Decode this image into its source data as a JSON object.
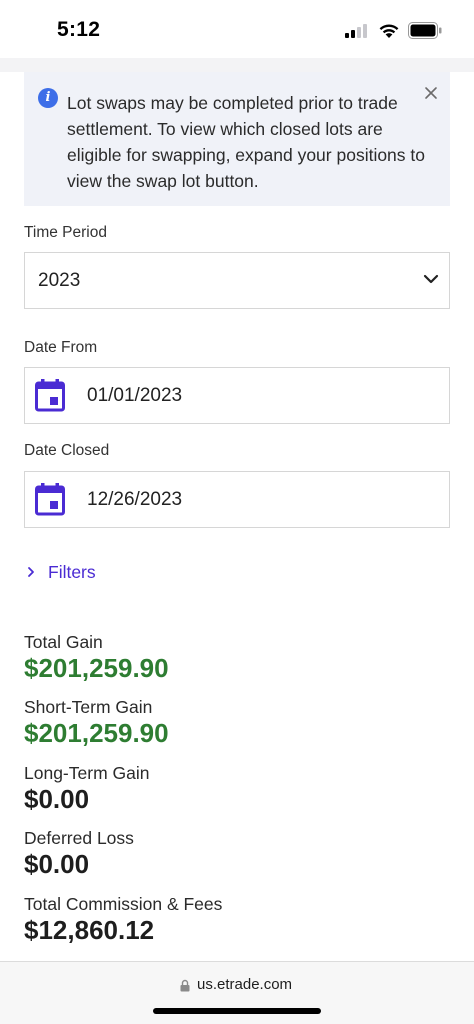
{
  "status_bar": {
    "time": "5:12"
  },
  "info_banner": {
    "text": "Lot swaps may be completed prior to trade settlement. To view which closed lots are eligible for swapping, expand your positions to view the swap lot button.",
    "icon": "info-icon",
    "close_icon": "close-icon",
    "accent_color": "#3d6ee8"
  },
  "time_period": {
    "label": "Time Period",
    "selected": "2023"
  },
  "date_from": {
    "label": "Date From",
    "value": "01/01/2023",
    "icon": "calendar-icon"
  },
  "date_closed": {
    "label": "Date Closed",
    "value": "12/26/2023",
    "icon": "calendar-icon"
  },
  "filters": {
    "label": "Filters",
    "color": "#4a2bd3"
  },
  "summary": {
    "total_gain": {
      "label": "Total Gain",
      "value": "$201,259.90"
    },
    "short_term_gain": {
      "label": "Short-Term Gain",
      "value": "$201,259.90"
    },
    "long_term_gain": {
      "label": "Long-Term Gain",
      "value": "$0.00"
    },
    "deferred_loss": {
      "label": "Deferred Loss",
      "value": "$0.00"
    },
    "commission_fees": {
      "label": "Total Commission & Fees",
      "value": "$12,860.12"
    },
    "gain_color": "#2e7d32"
  },
  "browser": {
    "url": "us.etrade.com"
  }
}
